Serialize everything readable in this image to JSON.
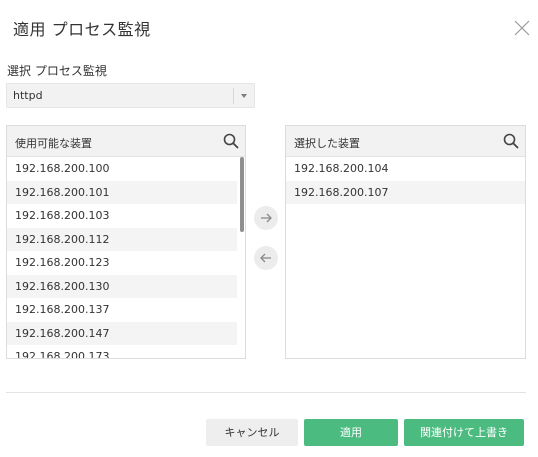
{
  "dialog": {
    "title": "適用 プロセス監視"
  },
  "process_select": {
    "label": "選択 プロセス監視",
    "value": "httpd"
  },
  "available_panel": {
    "title": "使用可能な装置",
    "items": [
      "192.168.200.100",
      "192.168.200.101",
      "192.168.200.103",
      "192.168.200.112",
      "192.168.200.123",
      "192.168.200.130",
      "192.168.200.137",
      "192.168.200.147",
      "192.168.200.173"
    ]
  },
  "selected_panel": {
    "title": "選択した装置",
    "items": [
      "192.168.200.104",
      "192.168.200.107"
    ]
  },
  "footer": {
    "cancel_label": "キャンセル",
    "apply_label": "適用",
    "link_overwrite_label": "関連付けて上書き"
  },
  "colors": {
    "accent": "#4cbb80",
    "panel_header": "#f2f2f2",
    "border": "#dcdcdc"
  },
  "icons": {
    "close": "close-icon",
    "search": "search-icon",
    "move_right": "arrow-right-icon",
    "move_left": "arrow-left-icon",
    "dropdown": "chevron-down-icon"
  }
}
